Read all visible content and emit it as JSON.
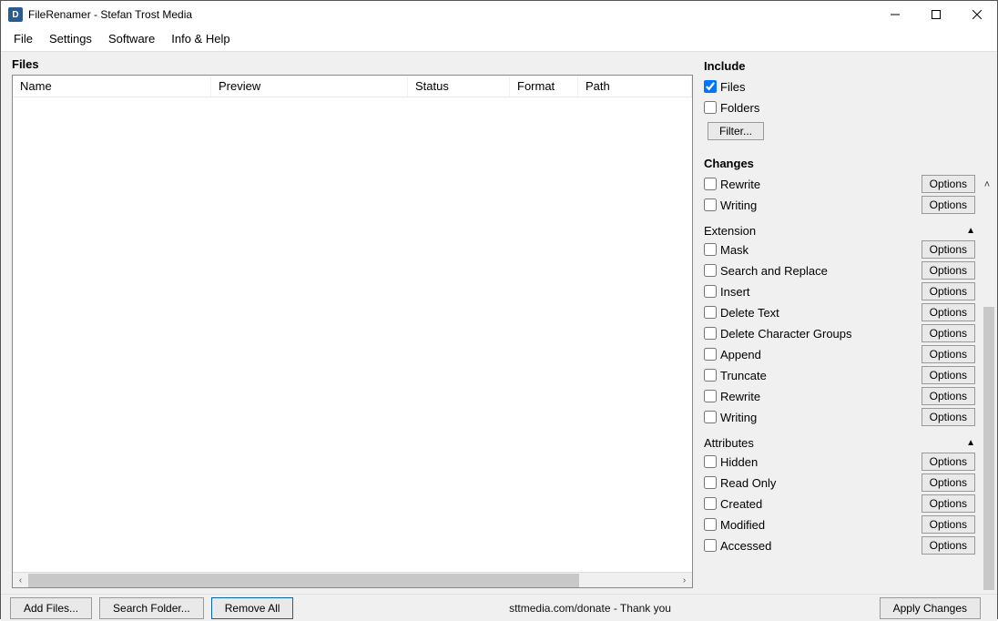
{
  "window": {
    "title": "FileRenamer - Stefan Trost Media",
    "icon_letter": "D"
  },
  "menu": {
    "file": "File",
    "settings": "Settings",
    "software": "Software",
    "info_help": "Info & Help"
  },
  "left": {
    "heading": "Files",
    "columns": {
      "name": "Name",
      "preview": "Preview",
      "status": "Status",
      "format": "Format",
      "path": "Path"
    }
  },
  "right": {
    "include": {
      "heading": "Include",
      "files": "Files",
      "folders": "Folders",
      "filter_btn": "Filter..."
    },
    "changes": {
      "heading": "Changes",
      "rewrite": "Rewrite",
      "writing": "Writing"
    },
    "extension": {
      "heading": "Extension",
      "mask": "Mask",
      "search_replace": "Search and Replace",
      "insert": "Insert",
      "delete_text": "Delete Text",
      "delete_char_groups": "Delete Character Groups",
      "append": "Append",
      "truncate": "Truncate",
      "rewrite": "Rewrite",
      "writing": "Writing"
    },
    "attributes": {
      "heading": "Attributes",
      "hidden": "Hidden",
      "read_only": "Read Only",
      "created": "Created",
      "modified": "Modified",
      "accessed": "Accessed"
    },
    "options_label": "Options"
  },
  "footer": {
    "add_files": "Add Files...",
    "search_folder": "Search Folder...",
    "remove_all": "Remove All",
    "donate": "sttmedia.com/donate - Thank you",
    "apply": "Apply Changes"
  }
}
